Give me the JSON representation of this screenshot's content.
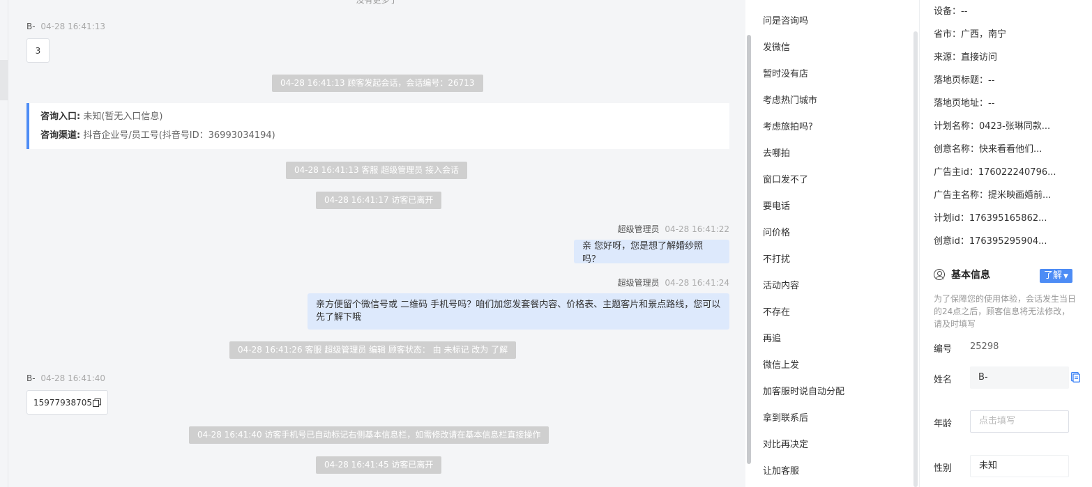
{
  "chat": {
    "top_note": "没有更多了",
    "messages": [
      {
        "sender": "B-",
        "time": "04-28 16:41:13",
        "text": "3"
      },
      {
        "system": "04-28 16:41:13 顾客发起会话，会话编号：26713"
      },
      {
        "system": "04-28 16:41:13 客服 超级管理员 接入会话"
      },
      {
        "system": "04-28 16:41:17 访客已离开"
      },
      {
        "sender": "超级管理员",
        "time": "04-28 16:41:22",
        "text": "亲 您好呀，您是想了解婚纱照吗？"
      },
      {
        "sender": "超级管理员",
        "time": "04-28 16:41:24",
        "text_line1": "亲方便留个微信号或 二维码 手机号吗？咱们加您发套餐内容、价格表、主题客片和景点路线，您可以",
        "text_line2": "先了解下哦"
      },
      {
        "system": "04-28 16:41:26 客服 超级管理员 编辑 顾客状态： 由 未标记 改为 了解"
      },
      {
        "sender": "B-",
        "time": "04-28 16:41:40",
        "text": "15977938705"
      },
      {
        "system": "04-28 16:41:40 访客手机号已自动标记右侧基本信息栏，如需修改请在基本信息栏直接操作"
      },
      {
        "system": "04-28 16:41:45 访客已离开"
      }
    ],
    "entry_card": {
      "entry_label": "咨询入口:",
      "entry_value": "未知(暂无入口信息)",
      "channel_label": "咨询渠道:",
      "channel_value": "抖音企业号/员工号(抖音号ID：36993034194)"
    }
  },
  "quick_replies": [
    "问是咨询吗",
    "发微信",
    "暂时没有店",
    "考虑热门城市",
    "考虑旅拍吗?",
    "去哪拍",
    "窗口发不了",
    "要电话",
    "问价格",
    "不打扰",
    "活动内容",
    "不存在",
    "再追",
    "微信上发",
    "加客服时说自动分配",
    "拿到联系后",
    "对比再决定",
    "让加客服"
  ],
  "info": {
    "items": [
      "设备：--",
      "省市：广西，南宁",
      "来源：直接访问",
      "落地页标题：--",
      "落地页地址：--",
      "计划名称：0423-张琳同款...",
      "创意名称：快来看看他们...",
      "广告主id：176022240796...",
      "广告主名称：提米映画婚前...",
      "计划id：176395165862...",
      "创意id：176395295904..."
    ],
    "basic_title": "基本信息",
    "status_button": "了解",
    "notice": "为了保障您的使用体验，会话发生当日的24点之后，顾客信息将无法修改，请及时填写",
    "fields": {
      "id_label": "编号",
      "id_value": "25298",
      "name_label": "姓名",
      "name_value": "B-",
      "age_label": "年龄",
      "age_placeholder": "点击填写",
      "gender_label": "性别",
      "gender_value": "未知"
    }
  }
}
